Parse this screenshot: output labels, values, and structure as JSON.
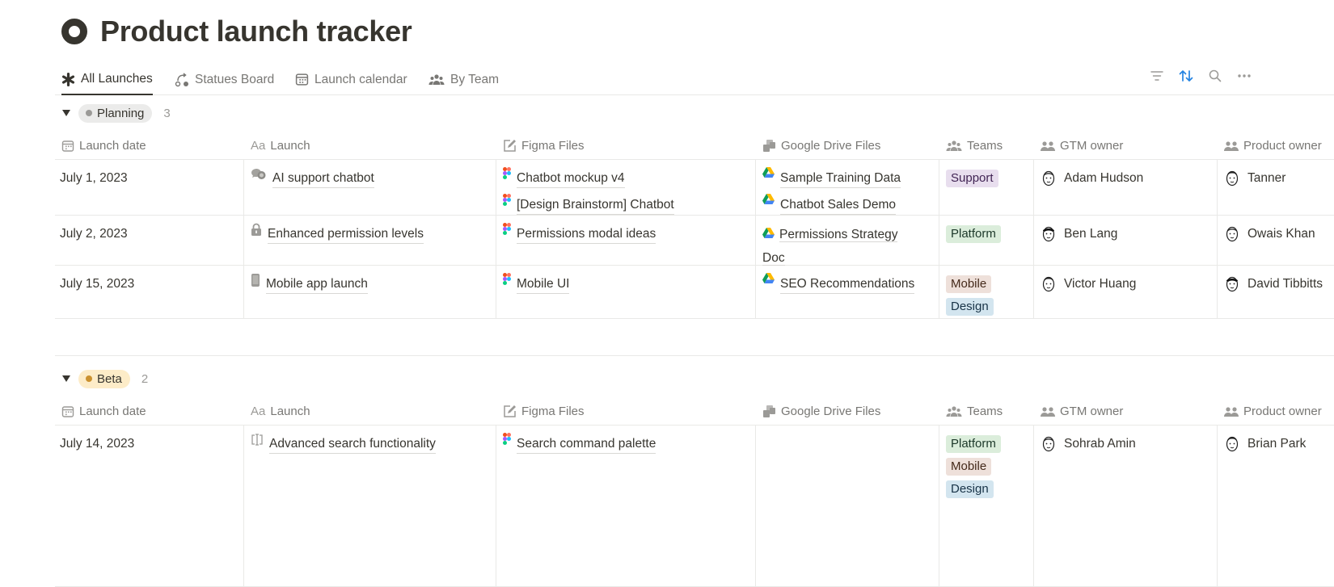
{
  "page": {
    "title": "Product launch tracker",
    "icon": "target-circle-icon"
  },
  "tabs": [
    {
      "label": "All Launches",
      "icon": "asterisk-icon",
      "active": true
    },
    {
      "label": "Statues Board",
      "icon": "board-flow-icon",
      "active": false
    },
    {
      "label": "Launch calendar",
      "icon": "calendar-icon",
      "active": false
    },
    {
      "label": "By Team",
      "icon": "people-icon",
      "active": false
    }
  ],
  "toolbar": [
    "filter-icon",
    "sort-icon",
    "search-icon",
    "more-icon"
  ],
  "colors": {
    "sort_active": "#2383e2",
    "planning_bg": "#ebebea",
    "planning_dot": "#9b9a97",
    "beta_bg": "#fdecc8",
    "beta_dot": "#cb912f"
  },
  "columns": [
    {
      "label": "Launch date",
      "icon": "calendar-icon"
    },
    {
      "label": "Launch",
      "icon": "text-aa-icon"
    },
    {
      "label": "Figma Files",
      "icon": "edit-square-icon"
    },
    {
      "label": "Google Drive Files",
      "icon": "files-icon"
    },
    {
      "label": "Teams",
      "icon": "people-icon"
    },
    {
      "label": "GTM owner",
      "icon": "person-pair-icon"
    },
    {
      "label": "Product owner",
      "icon": "person-pair-icon"
    }
  ],
  "tag_colors": {
    "Support": {
      "bg": "#e8deee",
      "fg": "#412454"
    },
    "Platform": {
      "bg": "#dbeddb",
      "fg": "#1c3829"
    },
    "Mobile": {
      "bg": "#eee0da",
      "fg": "#44291a"
    },
    "Design": {
      "bg": "#d3e5ef",
      "fg": "#183347"
    }
  },
  "groups": [
    {
      "label": "Planning",
      "count": "3",
      "rows": [
        {
          "date": "July 1, 2023",
          "launch": "AI support chatbot",
          "launch_icon": "chat-bubbles-icon",
          "figma": [
            "Chatbot mockup v4",
            "[Design Brainstorm] Chatbot"
          ],
          "drive": [
            "Sample Training Data",
            "Chatbot Sales Demo"
          ],
          "teams": [
            "Support"
          ],
          "gtm": "Adam Hudson",
          "product": "Tanner"
        },
        {
          "date": "July 2, 2023",
          "launch": "Enhanced permission levels",
          "launch_icon": "lock-icon",
          "figma": [
            "Permissions modal ideas"
          ],
          "drive": [
            "Permissions Strategy Doc"
          ],
          "teams": [
            "Platform"
          ],
          "gtm": "Ben Lang",
          "product": "Owais Khan"
        },
        {
          "date": "July 15, 2023",
          "launch": "Mobile app launch",
          "launch_icon": "phone-icon",
          "figma": [
            "Mobile UI"
          ],
          "drive": [
            "SEO Recommendations"
          ],
          "teams": [
            "Mobile",
            "Design"
          ],
          "gtm": "Victor Huang",
          "product": "David Tibbitts"
        }
      ]
    },
    {
      "label": "Beta",
      "count": "2",
      "rows": [
        {
          "date": "July 14, 2023",
          "launch": "Advanced search functionality",
          "launch_icon": "text-cursor-icon",
          "figma": [
            "Search command palette"
          ],
          "drive": [],
          "teams": [
            "Platform",
            "Mobile",
            "Design"
          ],
          "gtm": "Sohrab Amin",
          "product": "Brian Park"
        }
      ]
    }
  ]
}
